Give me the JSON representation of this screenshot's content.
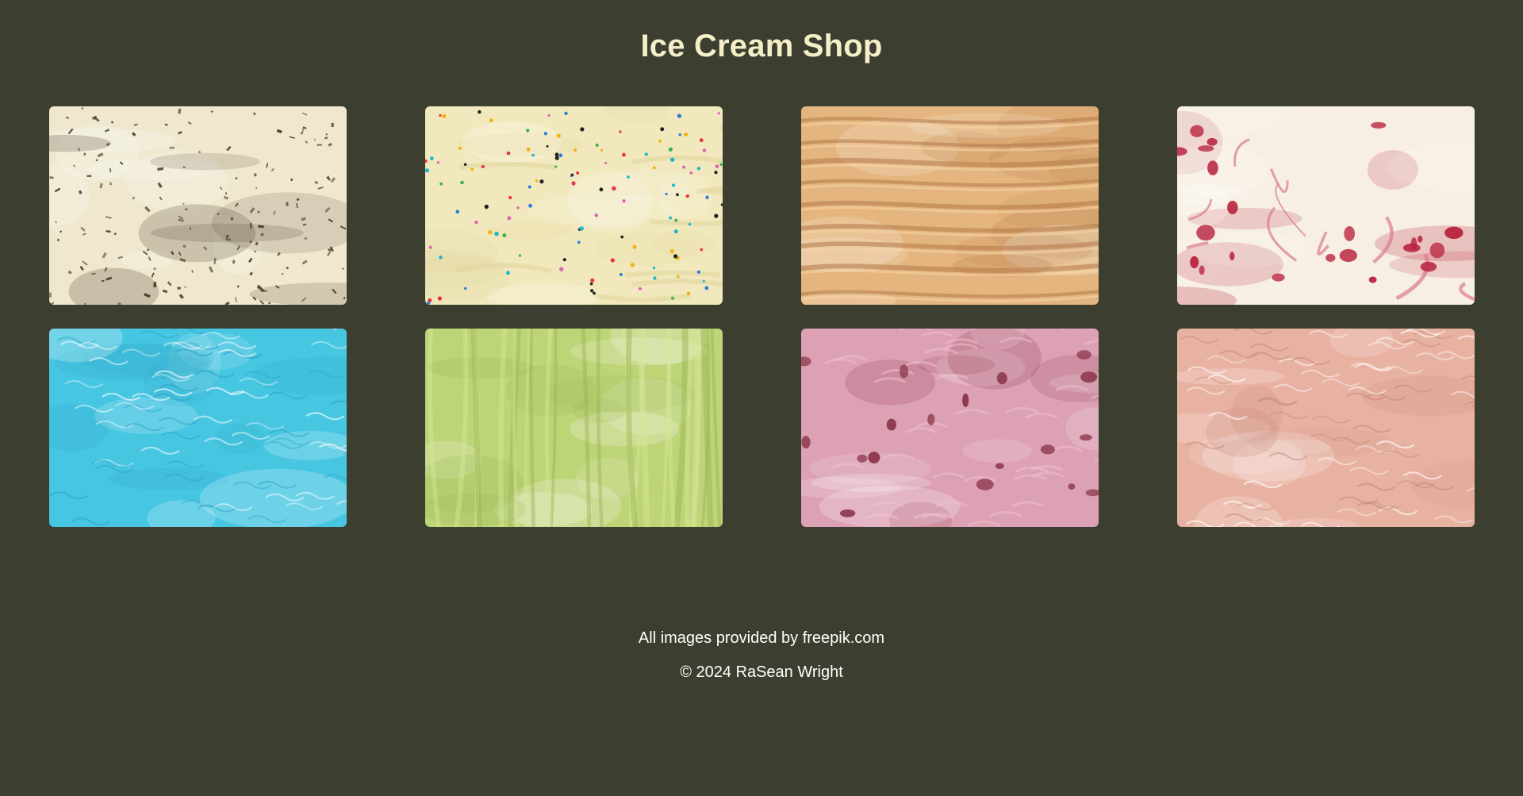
{
  "header": {
    "title": "Ice Cream Shop"
  },
  "gallery": {
    "items": [
      {
        "icon": "chocolate-chip-ice-cream-image",
        "base": "#efe8cf",
        "accent": "#4a3a28",
        "style": "flecks"
      },
      {
        "icon": "vanilla-sprinkles-ice-cream-image",
        "base": "#f1e9bd",
        "accent": "#e0d49c",
        "style": "sprinkles"
      },
      {
        "icon": "caramel-ice-cream-image",
        "base": "#e4b57e",
        "accent": "#b37848",
        "style": "waves"
      },
      {
        "icon": "cherry-vanilla-ice-cream-image",
        "base": "#f7efe3",
        "accent": "#b8223c",
        "style": "swirl"
      },
      {
        "icon": "blue-ice-cream-image",
        "base": "#47c6e2",
        "accent": "#2ba5c4",
        "style": "ripples"
      },
      {
        "icon": "pistachio-ice-cream-image",
        "base": "#bdd477",
        "accent": "#98b451",
        "style": "streaks"
      },
      {
        "icon": "strawberry-ice-cream-image",
        "base": "#dca1b4",
        "accent": "#8a3448",
        "style": "chunks"
      },
      {
        "icon": "peach-ice-cream-image",
        "base": "#e8b2a2",
        "accent": "#c68a7a",
        "style": "ripples"
      }
    ]
  },
  "footer": {
    "credit": "All images provided by freepik.com",
    "copyright": "© 2024 RaSean Wright"
  },
  "colors": {
    "background": "#3c3e2f",
    "title": "#f4efc8",
    "footer_text": "#ffffff"
  }
}
